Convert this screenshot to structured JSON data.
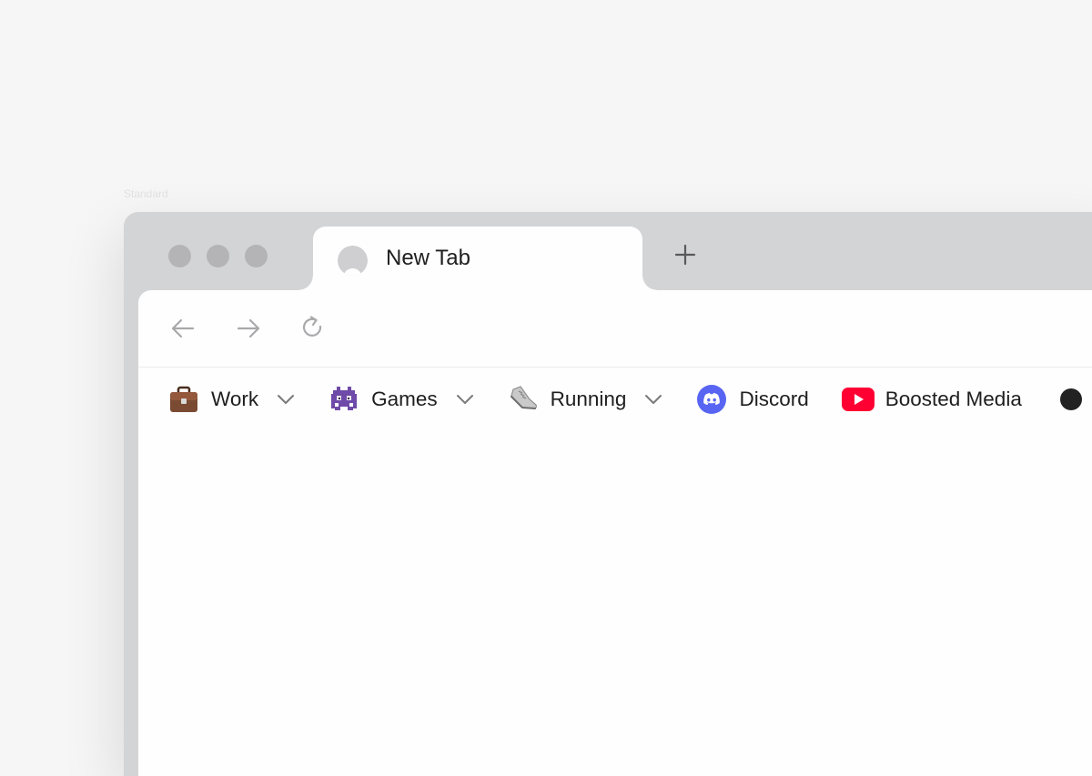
{
  "caption": "Standard",
  "tab": {
    "title": "New Tab"
  },
  "bookmarks": [
    {
      "label": "Work",
      "icon": "briefcase-icon",
      "folder": true
    },
    {
      "label": "Games",
      "icon": "space-invader-icon",
      "folder": true
    },
    {
      "label": "Running",
      "icon": "running-shoe-icon",
      "folder": true
    },
    {
      "label": "Discord",
      "icon": "discord-icon",
      "folder": false,
      "color": "#5865F2"
    },
    {
      "label": "Boosted Media",
      "icon": "youtube-icon",
      "folder": false,
      "color": "#FF0033"
    }
  ]
}
